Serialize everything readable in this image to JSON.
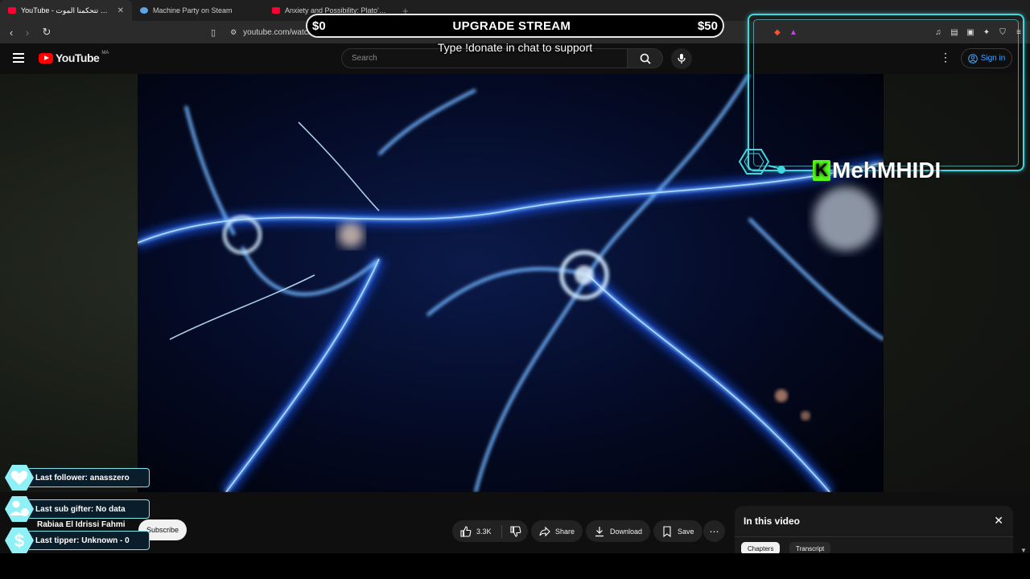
{
  "browser": {
    "tabs": [
      {
        "title": "YouTube - ؟ علاش تتحكمنا الموت",
        "active": true
      },
      {
        "title": "Machine Party on Steam",
        "active": false
      },
      {
        "title": "Anxiety and Possibility: Plato's Repub...",
        "active": false
      }
    ],
    "url": "youtube.com/watch?v=BZNohzPO7to"
  },
  "youtube": {
    "logo_text": "YouTube",
    "country_code": "MA",
    "search_placeholder": "Search",
    "signin_label": "Sign in"
  },
  "overlay": {
    "goal_current": "$0",
    "goal_title": "UPGRADE STREAM",
    "goal_target": "$50",
    "donate_hint": "Type !donate in chat to support",
    "streamer_name": "MehMHIDI",
    "alerts": [
      {
        "label": "Last follower: anasszero",
        "icon": "heart-icon"
      },
      {
        "label": "Last sub gifter: No data",
        "icon": "gift-sub-icon"
      },
      {
        "label": "Last tipper: Unknown - 0",
        "icon": "dollar-icon"
      }
    ]
  },
  "video_actions": {
    "channel_name": "Rabiaa El Idrissi Fahmi",
    "subscribe_label": "Subscribe",
    "like_count": "3.3K",
    "share_label": "Share",
    "download_label": "Download",
    "save_label": "Save"
  },
  "in_this_video": {
    "title": "In this video",
    "tabs": [
      "Chapters",
      "Transcript"
    ]
  },
  "colors": {
    "accent_cyan": "#3fd8e0",
    "youtube_red": "#ff0000",
    "kick_green": "#53fc18",
    "link_blue": "#3ea6ff"
  }
}
